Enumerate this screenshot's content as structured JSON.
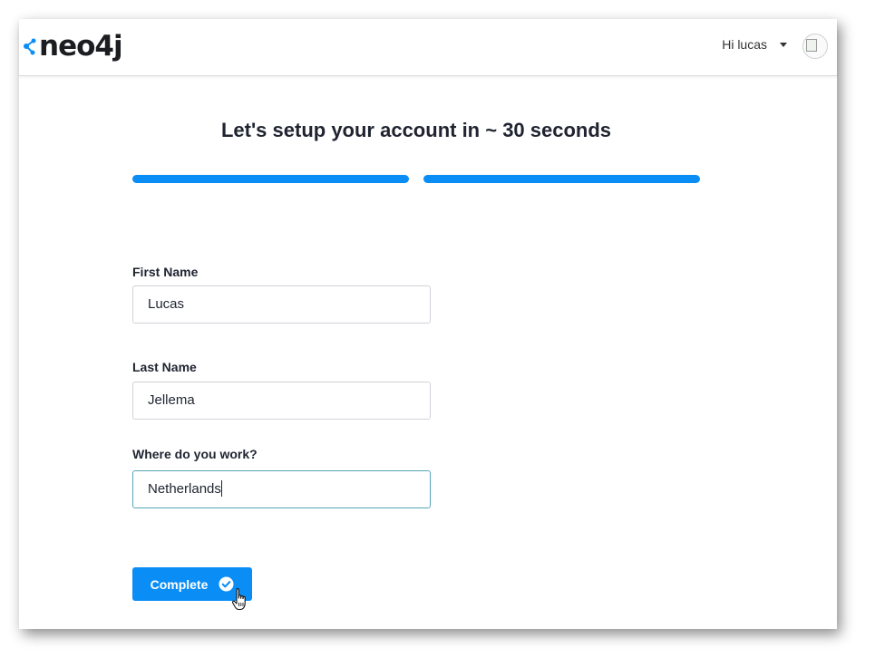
{
  "header": {
    "logo_text": "neo4j",
    "greeting": "Hi lucas",
    "avatar_alt": ""
  },
  "main": {
    "title": "Let's setup your account in ~ 30 seconds",
    "progress_steps": [
      {
        "state": "complete"
      },
      {
        "state": "complete"
      }
    ],
    "form": {
      "first_name_label": "First Name",
      "first_name_value": "Lucas",
      "last_name_label": "Last Name",
      "last_name_value": "Jellema",
      "work_label": "Where do you work?",
      "work_value": "Netherlands"
    },
    "complete_label": "Complete"
  },
  "colors": {
    "accent": "#0a8df5",
    "text": "#1f2430",
    "border": "#cfd3d8",
    "focus_border": "#56a6b8"
  },
  "icons": {
    "logo": "neo4j-graph-icon",
    "caret": "caret-down-icon",
    "avatar": "broken-image-icon",
    "check": "check-circle-icon",
    "cursor": "hand-pointer-icon"
  }
}
